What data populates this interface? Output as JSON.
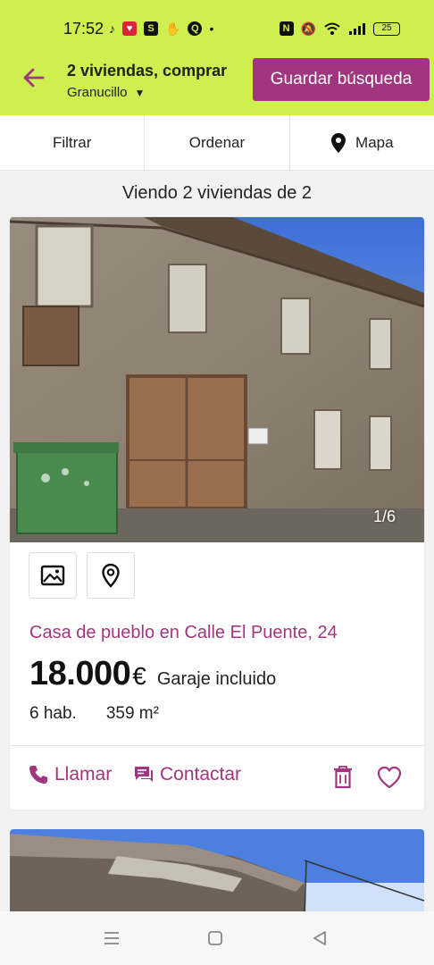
{
  "status_bar": {
    "time": "17:52",
    "battery": "25"
  },
  "header": {
    "title": "2 viviendas, comprar",
    "location": "Granucillo",
    "save_label": "Guardar búsqueda"
  },
  "toolbar": {
    "filter_label": "Filtrar",
    "sort_label": "Ordenar",
    "map_label": "Mapa"
  },
  "results": {
    "count_text": "Viendo 2 viviendas de 2"
  },
  "listing": {
    "photo_counter": "1/6",
    "title": "Casa de pueblo en Calle El Puente, 24",
    "price": "18.000",
    "currency": "€",
    "price_note": "Garaje incluido",
    "rooms": "6 hab.",
    "area": "359 m²",
    "call_label": "Llamar",
    "contact_label": "Contactar"
  },
  "icons": {
    "back": "arrow-left-icon",
    "map": "map-pin-icon",
    "photos": "image-icon",
    "location": "location-pin-icon",
    "call": "phone-icon",
    "contact": "chat-icon",
    "delete": "trash-icon",
    "favorite": "heart-icon"
  },
  "colors": {
    "brand_header": "#cfee4f",
    "accent": "#a23580"
  }
}
